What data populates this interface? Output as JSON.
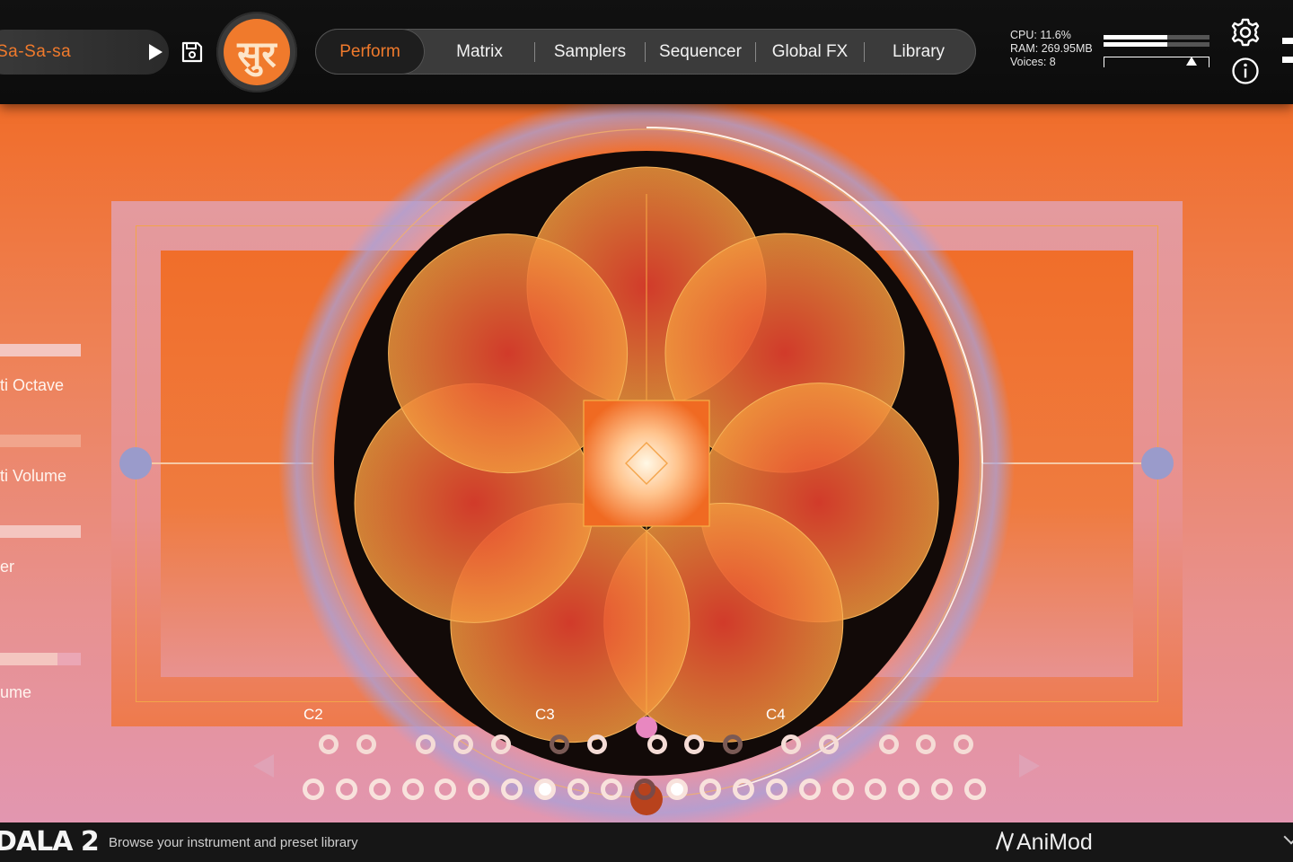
{
  "header": {
    "preset_name": "Sa-Sa-sa",
    "logo_glyph": "सुर",
    "tabs": [
      {
        "label": "Perform",
        "active": true
      },
      {
        "label": "Matrix",
        "active": false
      },
      {
        "label": "Samplers",
        "active": false
      },
      {
        "label": "Sequencer",
        "active": false
      },
      {
        "label": "Global FX",
        "active": false
      },
      {
        "label": "Library",
        "active": false
      }
    ],
    "stats": {
      "cpu": "CPU: 11.6%",
      "ram": "RAM: 269.95MB",
      "voices": "Voices: 8"
    },
    "meter_levels": [
      0.6,
      0.6
    ],
    "icons": [
      "play-icon",
      "save-icon",
      "gear-icon",
      "info-icon",
      "menu-icon"
    ]
  },
  "sidebar": {
    "labels": [
      "ti Octave",
      "ti Volume",
      "er",
      "ume"
    ]
  },
  "keyboard": {
    "note_labels": [
      "C2",
      "C3",
      "C4"
    ],
    "top_row_count": 15,
    "bottom_row_count": 21,
    "bottom_row_active": [
      7,
      11
    ]
  },
  "footer": {
    "brand": "DALA 2",
    "hint": "Browse your instrument and preset library",
    "maker": "AniMod"
  },
  "colors": {
    "accent": "#f07a2c",
    "handle": "#9a9bcb",
    "bg_dark": "#111111"
  }
}
